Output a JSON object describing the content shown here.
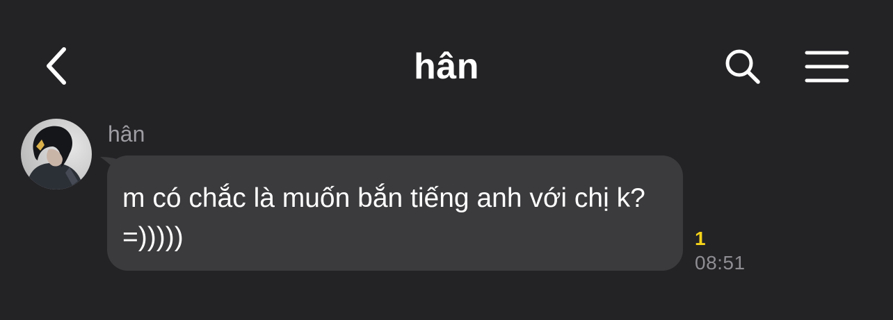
{
  "header": {
    "title": "hân",
    "back_icon": "chevron-left-icon",
    "search_icon": "search-icon",
    "menu_icon": "hamburger-menu-icon"
  },
  "message": {
    "sender": "hân",
    "text": "m có chắc là muốn bắn tiếng anh với chị k?=)))))",
    "unread_count": "1",
    "time": "08:51"
  },
  "colors": {
    "background": "#232326",
    "bubble": "#3b3b3e",
    "unread": "#f5d319",
    "meta_text": "#8e8e93"
  }
}
